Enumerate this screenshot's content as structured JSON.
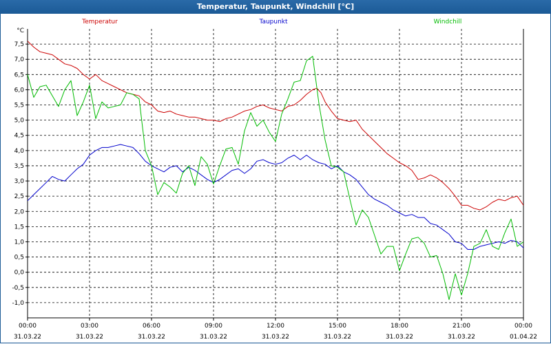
{
  "window": {
    "title": "Temperatur, Taupunkt, Windchill [°C]"
  },
  "chart_data": {
    "type": "line",
    "ylabel": "°C",
    "ylim": [
      -1.5,
      8.0
    ],
    "yticks": [
      -1.0,
      -0.5,
      0.0,
      0.5,
      1.0,
      1.5,
      2.0,
      2.5,
      3.0,
      3.5,
      4.0,
      4.5,
      5.0,
      5.5,
      6.0,
      6.5,
      7.0,
      7.5
    ],
    "ytick_labels": [
      "-1,0",
      "-0,5",
      "0,0",
      "0,5",
      "1,0",
      "1,5",
      "2,0",
      "2,5",
      "3,0",
      "3,5",
      "4,0",
      "4,5",
      "5,0",
      "5,5",
      "6,0",
      "6,5",
      "7,0",
      "7,5"
    ],
    "xlim": [
      0,
      24
    ],
    "xticks": [
      0,
      3,
      6,
      9,
      12,
      15,
      18,
      21,
      24
    ],
    "xtick_times": [
      "00:00",
      "03:00",
      "06:00",
      "09:00",
      "12:00",
      "15:00",
      "18:00",
      "21:00",
      "00:00"
    ],
    "xtick_dates": [
      "31.03.22",
      "31.03.22",
      "31.03.22",
      "31.03.22",
      "31.03.22",
      "31.03.22",
      "31.03.22",
      "31.03.22",
      "01.04.22"
    ],
    "grid": true,
    "legend_position": "top",
    "series": [
      {
        "name": "Temperatur",
        "color": "#cc0000",
        "x": [
          0.0,
          0.3,
          0.6,
          0.9,
          1.2,
          1.5,
          1.8,
          2.1,
          2.4,
          2.7,
          3.0,
          3.3,
          3.6,
          3.9,
          4.2,
          4.5,
          4.8,
          5.1,
          5.4,
          5.7,
          6.0,
          6.3,
          6.6,
          6.9,
          7.2,
          7.5,
          7.8,
          8.1,
          8.4,
          8.7,
          9.0,
          9.3,
          9.6,
          9.9,
          10.2,
          10.5,
          10.8,
          11.1,
          11.4,
          11.7,
          12.0,
          12.3,
          12.6,
          12.9,
          13.2,
          13.5,
          13.8,
          14.0,
          14.2,
          14.4,
          14.7,
          15.0,
          15.3,
          15.6,
          15.9,
          16.2,
          16.5,
          16.8,
          17.1,
          17.4,
          17.7,
          18.0,
          18.3,
          18.6,
          18.9,
          19.2,
          19.5,
          19.8,
          20.1,
          20.4,
          20.7,
          21.0,
          21.3,
          21.6,
          21.9,
          22.2,
          22.5,
          22.8,
          23.1,
          23.4,
          23.7,
          24.0
        ],
        "values": [
          7.6,
          7.4,
          7.25,
          7.2,
          7.15,
          7.0,
          6.85,
          6.8,
          6.7,
          6.5,
          6.35,
          6.5,
          6.3,
          6.2,
          6.1,
          6.0,
          5.9,
          5.85,
          5.8,
          5.6,
          5.5,
          5.3,
          5.25,
          5.3,
          5.2,
          5.15,
          5.1,
          5.1,
          5.05,
          5.0,
          5.0,
          4.95,
          5.05,
          5.1,
          5.2,
          5.3,
          5.35,
          5.45,
          5.5,
          5.4,
          5.35,
          5.3,
          5.45,
          5.5,
          5.65,
          5.85,
          6.0,
          6.05,
          5.9,
          5.6,
          5.3,
          5.05,
          5.0,
          4.95,
          5.0,
          4.7,
          4.5,
          4.3,
          4.1,
          3.9,
          3.75,
          3.6,
          3.5,
          3.35,
          3.05,
          3.1,
          3.2,
          3.1,
          2.95,
          2.75,
          2.5,
          2.2,
          2.2,
          2.1,
          2.05,
          2.15,
          2.3,
          2.4,
          2.35,
          2.45,
          2.5,
          2.2
        ]
      },
      {
        "name": "Taupunkt",
        "color": "#0000cc",
        "x": [
          0.0,
          0.3,
          0.6,
          0.9,
          1.2,
          1.5,
          1.8,
          2.1,
          2.4,
          2.7,
          3.0,
          3.3,
          3.6,
          3.9,
          4.2,
          4.5,
          4.8,
          5.1,
          5.4,
          5.7,
          6.0,
          6.3,
          6.6,
          6.9,
          7.2,
          7.5,
          7.8,
          8.1,
          8.4,
          8.7,
          9.0,
          9.3,
          9.6,
          9.9,
          10.2,
          10.5,
          10.8,
          11.1,
          11.4,
          11.7,
          12.0,
          12.3,
          12.6,
          12.9,
          13.2,
          13.5,
          13.8,
          14.1,
          14.4,
          14.7,
          15.0,
          15.3,
          15.6,
          15.9,
          16.2,
          16.5,
          16.8,
          17.1,
          17.4,
          17.7,
          18.0,
          18.3,
          18.6,
          18.9,
          19.2,
          19.5,
          19.8,
          20.1,
          20.4,
          20.7,
          21.0,
          21.3,
          21.6,
          21.9,
          22.2,
          22.5,
          22.8,
          23.1,
          23.4,
          23.7,
          24.0
        ],
        "values": [
          2.35,
          2.55,
          2.75,
          2.95,
          3.15,
          3.05,
          3.0,
          3.2,
          3.4,
          3.55,
          3.85,
          4.0,
          4.1,
          4.1,
          4.15,
          4.2,
          4.15,
          4.1,
          3.9,
          3.65,
          3.5,
          3.4,
          3.3,
          3.45,
          3.5,
          3.3,
          3.45,
          3.35,
          3.2,
          3.05,
          2.95,
          3.05,
          3.2,
          3.35,
          3.4,
          3.25,
          3.4,
          3.65,
          3.7,
          3.6,
          3.55,
          3.6,
          3.75,
          3.85,
          3.7,
          3.85,
          3.7,
          3.6,
          3.55,
          3.4,
          3.5,
          3.3,
          3.2,
          3.05,
          2.8,
          2.55,
          2.4,
          2.3,
          2.2,
          2.05,
          1.95,
          1.85,
          1.9,
          1.8,
          1.8,
          1.6,
          1.55,
          1.4,
          1.25,
          1.0,
          0.95,
          0.75,
          0.75,
          0.85,
          0.9,
          0.95,
          1.0,
          0.95,
          1.05,
          1.0,
          0.8
        ]
      },
      {
        "name": "Windchill",
        "color": "#00bb00",
        "x": [
          0.0,
          0.3,
          0.6,
          0.9,
          1.2,
          1.5,
          1.8,
          2.1,
          2.4,
          2.7,
          3.0,
          3.3,
          3.6,
          3.9,
          4.2,
          4.5,
          4.8,
          5.1,
          5.4,
          5.7,
          6.0,
          6.3,
          6.6,
          6.9,
          7.2,
          7.5,
          7.8,
          8.1,
          8.4,
          8.7,
          9.0,
          9.3,
          9.6,
          9.9,
          10.2,
          10.5,
          10.8,
          11.1,
          11.4,
          11.7,
          12.0,
          12.3,
          12.6,
          12.9,
          13.2,
          13.5,
          13.8,
          14.1,
          14.4,
          14.7,
          15.0,
          15.3,
          15.6,
          15.9,
          16.2,
          16.5,
          16.8,
          17.1,
          17.4,
          17.7,
          18.0,
          18.3,
          18.6,
          18.9,
          19.2,
          19.5,
          19.8,
          20.1,
          20.4,
          20.7,
          21.0,
          21.3,
          21.6,
          21.9,
          22.2,
          22.5,
          22.8,
          23.1,
          23.4,
          23.7,
          24.0
        ],
        "values": [
          6.5,
          5.75,
          6.1,
          6.15,
          5.8,
          5.45,
          6.0,
          6.3,
          5.15,
          5.6,
          6.15,
          5.05,
          5.6,
          5.4,
          5.45,
          5.5,
          5.9,
          5.85,
          5.7,
          4.0,
          3.5,
          2.55,
          2.95,
          2.8,
          2.6,
          3.25,
          3.5,
          2.85,
          3.8,
          3.55,
          2.9,
          3.5,
          4.05,
          4.1,
          3.55,
          4.65,
          5.25,
          4.8,
          5.0,
          4.6,
          4.3,
          5.2,
          5.7,
          6.25,
          6.3,
          6.95,
          7.1,
          5.55,
          4.35,
          3.5,
          3.45,
          3.3,
          2.4,
          1.55,
          2.05,
          1.8,
          1.2,
          0.6,
          0.85,
          0.85,
          0.05,
          0.6,
          1.1,
          1.15,
          0.95,
          0.5,
          0.55,
          -0.05,
          -0.9,
          -0.05,
          -0.75,
          -0.05,
          0.85,
          0.95,
          1.4,
          0.85,
          0.75,
          1.3,
          1.75,
          0.85,
          1.0
        ]
      }
    ]
  }
}
